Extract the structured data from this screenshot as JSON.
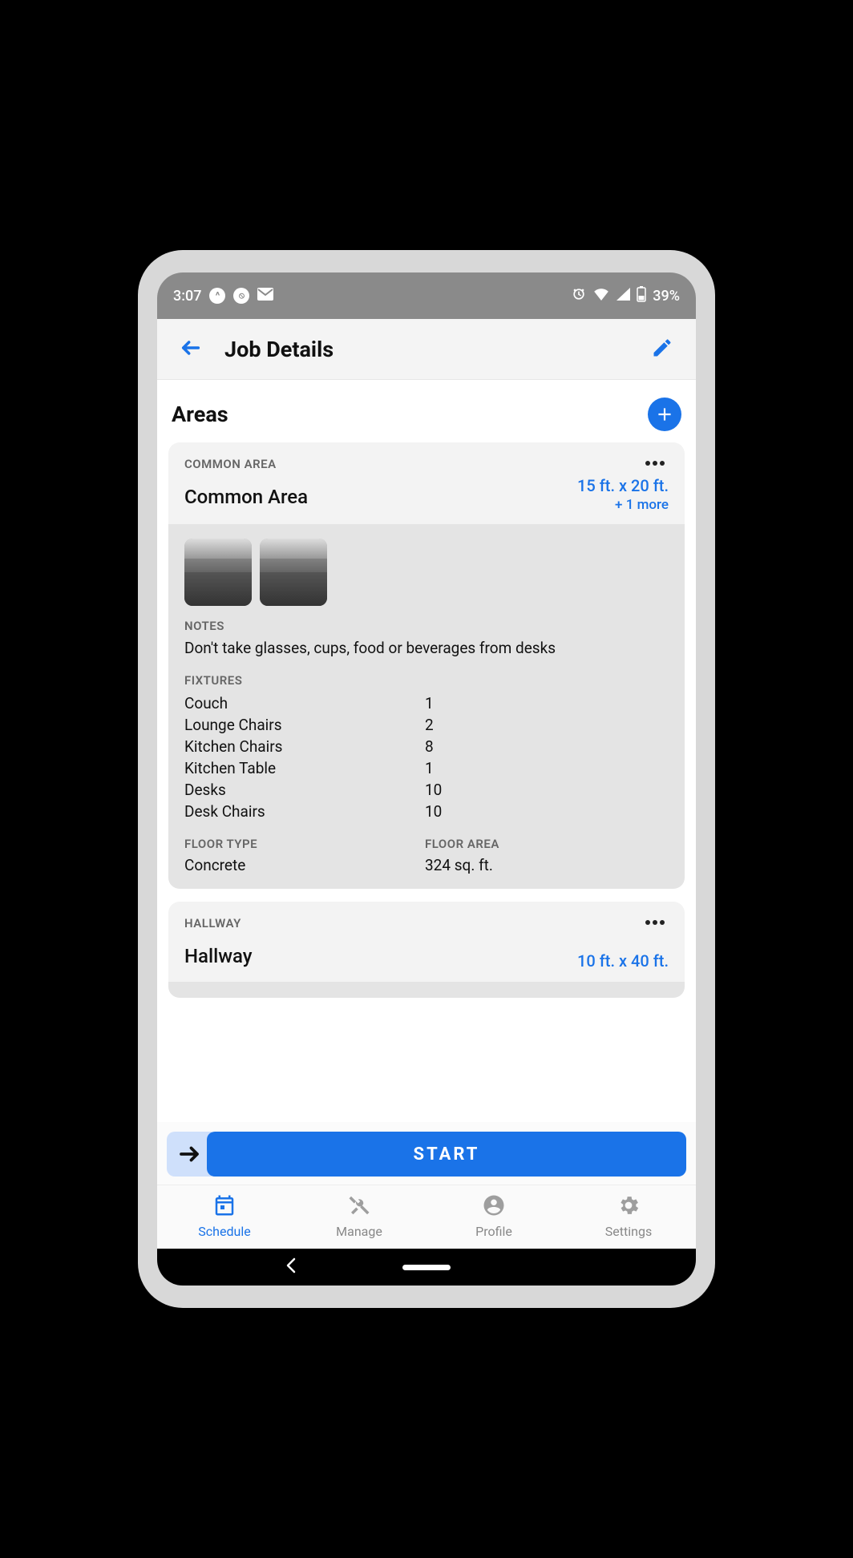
{
  "status_bar": {
    "time": "3:07",
    "battery_percent": "39%"
  },
  "header": {
    "title": "Job Details"
  },
  "section": {
    "title": "Areas"
  },
  "areas": [
    {
      "category": "COMMON AREA",
      "name": "Common Area",
      "dimensions": "15 ft. x 20 ft.",
      "more_link": "+ 1 more",
      "notes_label": "NOTES",
      "notes": "Don't take glasses, cups, food or beverages from desks",
      "fixtures_label": "FIXTURES",
      "fixtures": [
        {
          "name": "Couch",
          "qty": "1"
        },
        {
          "name": "Lounge Chairs",
          "qty": "2"
        },
        {
          "name": "Kitchen Chairs",
          "qty": "8"
        },
        {
          "name": "Kitchen Table",
          "qty": "1"
        },
        {
          "name": "Desks",
          "qty": "10"
        },
        {
          "name": "Desk Chairs",
          "qty": "10"
        }
      ],
      "floor_type_label": "FLOOR TYPE",
      "floor_type": "Concrete",
      "floor_area_label": "FLOOR AREA",
      "floor_area": "324 sq. ft."
    },
    {
      "category": "HALLWAY",
      "name": "Hallway",
      "dimensions": "10 ft. x 40 ft."
    }
  ],
  "start_button": "START",
  "tabs": [
    {
      "label": "Schedule",
      "active": true
    },
    {
      "label": "Manage",
      "active": false
    },
    {
      "label": "Profile",
      "active": false
    },
    {
      "label": "Settings",
      "active": false
    }
  ]
}
